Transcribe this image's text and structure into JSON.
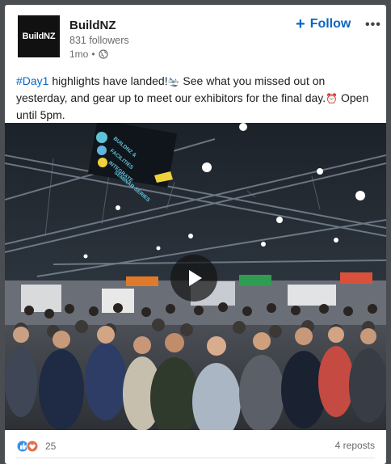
{
  "post": {
    "company_name": "BuildNZ",
    "logo_text": "BuildNZ",
    "followers": "831 followers",
    "age": "1mo",
    "separator": "•",
    "follow_label": "Follow",
    "follow_plus": "+",
    "more_label": "•••",
    "text": {
      "hashtag": "#Day1",
      "line1": " highlights have landed!",
      "emoji1": "🛬",
      "line2": " See what you missed out on yesterday, and gear up to meet our exhibitors for the final day.",
      "emoji2": "⏰",
      "line3": " Open until 5pm."
    },
    "media": {
      "banner_text": "BUILDNZ & FACILITIES INTEGRATE SEMINAR SERIES",
      "play_icon": "play-icon"
    },
    "reactions_count": "25",
    "reposts": "4 reposts"
  },
  "colors": {
    "accent": "#0a66c2",
    "like_blue": "#378fe9",
    "love_red": "#df704d"
  }
}
